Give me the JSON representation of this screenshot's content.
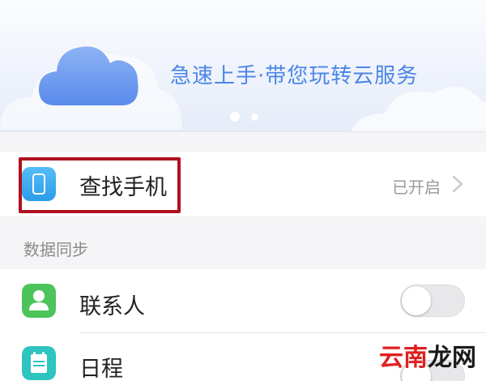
{
  "banner": {
    "tagline": "急速上手·带您玩转云服务",
    "dots": 2,
    "active_dot": 1,
    "cloud_icon": "cloud-icon"
  },
  "find_phone": {
    "label": "查找手机",
    "status": "已开启",
    "icon": "phone-icon",
    "highlighted": true,
    "highlight_color": "#b01020"
  },
  "data_sync": {
    "header": "数据同步",
    "items": [
      {
        "label": "联系人",
        "icon": "contact-icon",
        "enabled": false
      },
      {
        "label": "日程",
        "icon": "calendar-icon",
        "enabled": false
      }
    ]
  },
  "watermark": {
    "part_a": "云",
    "part_b": "南",
    "part_c": "龙网"
  },
  "colors": {
    "accent_blue": "#4a86e8",
    "contact_green": "#4cc45a",
    "calendar_teal": "#2ec4c0"
  }
}
